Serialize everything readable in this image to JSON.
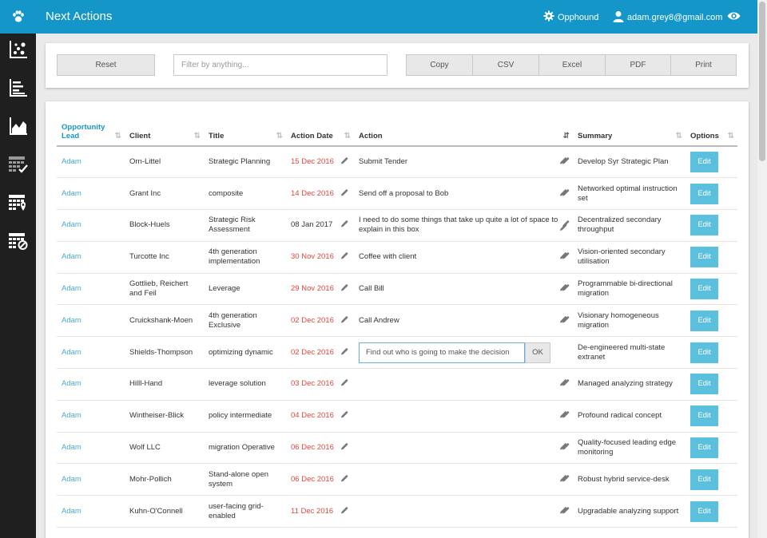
{
  "header": {
    "title": "Next Actions",
    "org_name": "Opphound",
    "user_email": "adam.grey8@gmail.com"
  },
  "sidebar": {
    "items": [
      {
        "icon": "scatter-chart-icon"
      },
      {
        "icon": "list-chart-icon"
      },
      {
        "icon": "area-chart-icon"
      },
      {
        "icon": "calendar-check-icon"
      },
      {
        "icon": "calendar-pin-icon"
      },
      {
        "icon": "calendar-block-icon"
      }
    ]
  },
  "toolbar": {
    "reset_label": "Reset",
    "filter_placeholder": "Filter by anything...",
    "export_buttons": [
      "Copy",
      "CSV",
      "Excel",
      "PDF",
      "Print"
    ]
  },
  "table": {
    "columns": {
      "lead": "Opportunity Lead",
      "client": "Client",
      "title": "Title",
      "action_date": "Action Date",
      "action": "Action",
      "summary": "Summary",
      "options": "Options"
    },
    "edit_label": "Edit",
    "ok_label": "OK",
    "rows": [
      {
        "lead": "Adam",
        "client": "Orn-Littel",
        "title": "Strategic Planning",
        "date": "15 Dec 2016",
        "overdue": true,
        "action": "Submit Tender",
        "summary": "Develop Syr Strategic Plan"
      },
      {
        "lead": "Adam",
        "client": "Grant Inc",
        "title": "composite",
        "date": "14 Dec 2016",
        "overdue": true,
        "action": "Send off a proposal to Bob",
        "summary": "Networked optimal instruction set"
      },
      {
        "lead": "Adam",
        "client": "Block-Huels",
        "title": "Strategic Risk Assessment",
        "date": "08 Jan 2017",
        "overdue": false,
        "action": "I need to do some things that take up quite a lot of space to explain in this box",
        "summary": "Decentralized secondary throughput"
      },
      {
        "lead": "Adam",
        "client": "Turcotte Inc",
        "title": "4th generation implementation",
        "date": "30 Nov 2016",
        "overdue": true,
        "action": "Coffee with client",
        "summary": "Vision-oriented secondary utilisation"
      },
      {
        "lead": "Adam",
        "client": "Gottlieb, Reichert and Feil",
        "title": "Leverage",
        "date": "29 Nov 2016",
        "overdue": true,
        "action": "Call Bill",
        "summary": "Programmable bi-directional migration"
      },
      {
        "lead": "Adam",
        "client": "Cruickshank-Moen",
        "title": "4th generation Exclusive",
        "date": "02 Dec 2016",
        "overdue": true,
        "action": "Call Andrew",
        "summary": "Visionary homogeneous migration"
      },
      {
        "lead": "Adam",
        "client": "Shields-Thompson",
        "title": "optimizing dynamic",
        "date": "02 Dec 2016",
        "overdue": true,
        "action": "",
        "editing_value": "Find out who is going to make the decision",
        "summary": "De-engineered multi-state extranet"
      },
      {
        "lead": "Adam",
        "client": "Hilll-Hand",
        "title": "leverage solution",
        "date": "03 Dec 2016",
        "overdue": true,
        "action": "",
        "summary": "Managed analyzing strategy"
      },
      {
        "lead": "Adam",
        "client": "Wintheiser-Blick",
        "title": "policy intermediate",
        "date": "04 Dec 2016",
        "overdue": true,
        "action": "",
        "summary": "Profound radical concept"
      },
      {
        "lead": "Adam",
        "client": "Wolf LLC",
        "title": "migration Operative",
        "date": "06 Dec 2016",
        "overdue": true,
        "action": "",
        "summary": "Quality-focused leading edge monitoring"
      },
      {
        "lead": "Adam",
        "client": "Mohr-Pollich",
        "title": "Stand-alone open system",
        "date": "06 Dec 2016",
        "overdue": true,
        "action": "",
        "summary": "Robust hybrid service-desk"
      },
      {
        "lead": "Adam",
        "client": "Kuhn-O'Connell",
        "title": "user-facing grid-enabled",
        "date": "11 Dec 2016",
        "overdue": true,
        "action": "",
        "summary": "Upgradable analyzing support"
      }
    ]
  },
  "colors": {
    "brand": "#1596c9",
    "overdue": "#e0483c",
    "edit": "#5bc0de"
  }
}
